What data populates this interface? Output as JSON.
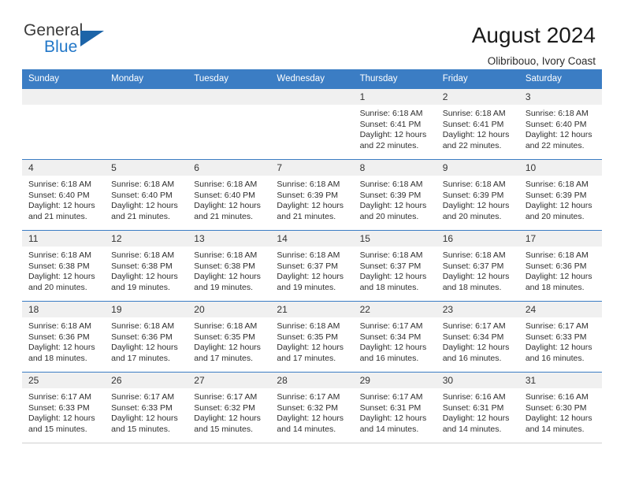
{
  "brand": {
    "name_part1": "General",
    "name_part2": "Blue",
    "triangle_color": "#1c64a8"
  },
  "header": {
    "title": "August 2024",
    "subtitle": "Olibribouo, Ivory Coast"
  },
  "theme": {
    "accent": "#3b7dc4",
    "header_text": "#ffffff",
    "daynum_band": "#f0f0f0",
    "body_text": "#2e2e2e"
  },
  "calendar": {
    "weekday_headers": [
      "Sunday",
      "Monday",
      "Tuesday",
      "Wednesday",
      "Thursday",
      "Friday",
      "Saturday"
    ],
    "weeks": [
      [
        {
          "day": "",
          "empty": true,
          "sunrise": "",
          "sunset": "",
          "daylight_line1": "",
          "daylight_line2": ""
        },
        {
          "day": "",
          "empty": true,
          "sunrise": "",
          "sunset": "",
          "daylight_line1": "",
          "daylight_line2": ""
        },
        {
          "day": "",
          "empty": true,
          "sunrise": "",
          "sunset": "",
          "daylight_line1": "",
          "daylight_line2": ""
        },
        {
          "day": "",
          "empty": true,
          "sunrise": "",
          "sunset": "",
          "daylight_line1": "",
          "daylight_line2": ""
        },
        {
          "day": "1",
          "empty": false,
          "sunrise": "Sunrise: 6:18 AM",
          "sunset": "Sunset: 6:41 PM",
          "daylight_line1": "Daylight: 12 hours",
          "daylight_line2": "and 22 minutes."
        },
        {
          "day": "2",
          "empty": false,
          "sunrise": "Sunrise: 6:18 AM",
          "sunset": "Sunset: 6:41 PM",
          "daylight_line1": "Daylight: 12 hours",
          "daylight_line2": "and 22 minutes."
        },
        {
          "day": "3",
          "empty": false,
          "sunrise": "Sunrise: 6:18 AM",
          "sunset": "Sunset: 6:40 PM",
          "daylight_line1": "Daylight: 12 hours",
          "daylight_line2": "and 22 minutes."
        }
      ],
      [
        {
          "day": "4",
          "empty": false,
          "sunrise": "Sunrise: 6:18 AM",
          "sunset": "Sunset: 6:40 PM",
          "daylight_line1": "Daylight: 12 hours",
          "daylight_line2": "and 21 minutes."
        },
        {
          "day": "5",
          "empty": false,
          "sunrise": "Sunrise: 6:18 AM",
          "sunset": "Sunset: 6:40 PM",
          "daylight_line1": "Daylight: 12 hours",
          "daylight_line2": "and 21 minutes."
        },
        {
          "day": "6",
          "empty": false,
          "sunrise": "Sunrise: 6:18 AM",
          "sunset": "Sunset: 6:40 PM",
          "daylight_line1": "Daylight: 12 hours",
          "daylight_line2": "and 21 minutes."
        },
        {
          "day": "7",
          "empty": false,
          "sunrise": "Sunrise: 6:18 AM",
          "sunset": "Sunset: 6:39 PM",
          "daylight_line1": "Daylight: 12 hours",
          "daylight_line2": "and 21 minutes."
        },
        {
          "day": "8",
          "empty": false,
          "sunrise": "Sunrise: 6:18 AM",
          "sunset": "Sunset: 6:39 PM",
          "daylight_line1": "Daylight: 12 hours",
          "daylight_line2": "and 20 minutes."
        },
        {
          "day": "9",
          "empty": false,
          "sunrise": "Sunrise: 6:18 AM",
          "sunset": "Sunset: 6:39 PM",
          "daylight_line1": "Daylight: 12 hours",
          "daylight_line2": "and 20 minutes."
        },
        {
          "day": "10",
          "empty": false,
          "sunrise": "Sunrise: 6:18 AM",
          "sunset": "Sunset: 6:39 PM",
          "daylight_line1": "Daylight: 12 hours",
          "daylight_line2": "and 20 minutes."
        }
      ],
      [
        {
          "day": "11",
          "empty": false,
          "sunrise": "Sunrise: 6:18 AM",
          "sunset": "Sunset: 6:38 PM",
          "daylight_line1": "Daylight: 12 hours",
          "daylight_line2": "and 20 minutes."
        },
        {
          "day": "12",
          "empty": false,
          "sunrise": "Sunrise: 6:18 AM",
          "sunset": "Sunset: 6:38 PM",
          "daylight_line1": "Daylight: 12 hours",
          "daylight_line2": "and 19 minutes."
        },
        {
          "day": "13",
          "empty": false,
          "sunrise": "Sunrise: 6:18 AM",
          "sunset": "Sunset: 6:38 PM",
          "daylight_line1": "Daylight: 12 hours",
          "daylight_line2": "and 19 minutes."
        },
        {
          "day": "14",
          "empty": false,
          "sunrise": "Sunrise: 6:18 AM",
          "sunset": "Sunset: 6:37 PM",
          "daylight_line1": "Daylight: 12 hours",
          "daylight_line2": "and 19 minutes."
        },
        {
          "day": "15",
          "empty": false,
          "sunrise": "Sunrise: 6:18 AM",
          "sunset": "Sunset: 6:37 PM",
          "daylight_line1": "Daylight: 12 hours",
          "daylight_line2": "and 18 minutes."
        },
        {
          "day": "16",
          "empty": false,
          "sunrise": "Sunrise: 6:18 AM",
          "sunset": "Sunset: 6:37 PM",
          "daylight_line1": "Daylight: 12 hours",
          "daylight_line2": "and 18 minutes."
        },
        {
          "day": "17",
          "empty": false,
          "sunrise": "Sunrise: 6:18 AM",
          "sunset": "Sunset: 6:36 PM",
          "daylight_line1": "Daylight: 12 hours",
          "daylight_line2": "and 18 minutes."
        }
      ],
      [
        {
          "day": "18",
          "empty": false,
          "sunrise": "Sunrise: 6:18 AM",
          "sunset": "Sunset: 6:36 PM",
          "daylight_line1": "Daylight: 12 hours",
          "daylight_line2": "and 18 minutes."
        },
        {
          "day": "19",
          "empty": false,
          "sunrise": "Sunrise: 6:18 AM",
          "sunset": "Sunset: 6:36 PM",
          "daylight_line1": "Daylight: 12 hours",
          "daylight_line2": "and 17 minutes."
        },
        {
          "day": "20",
          "empty": false,
          "sunrise": "Sunrise: 6:18 AM",
          "sunset": "Sunset: 6:35 PM",
          "daylight_line1": "Daylight: 12 hours",
          "daylight_line2": "and 17 minutes."
        },
        {
          "day": "21",
          "empty": false,
          "sunrise": "Sunrise: 6:18 AM",
          "sunset": "Sunset: 6:35 PM",
          "daylight_line1": "Daylight: 12 hours",
          "daylight_line2": "and 17 minutes."
        },
        {
          "day": "22",
          "empty": false,
          "sunrise": "Sunrise: 6:17 AM",
          "sunset": "Sunset: 6:34 PM",
          "daylight_line1": "Daylight: 12 hours",
          "daylight_line2": "and 16 minutes."
        },
        {
          "day": "23",
          "empty": false,
          "sunrise": "Sunrise: 6:17 AM",
          "sunset": "Sunset: 6:34 PM",
          "daylight_line1": "Daylight: 12 hours",
          "daylight_line2": "and 16 minutes."
        },
        {
          "day": "24",
          "empty": false,
          "sunrise": "Sunrise: 6:17 AM",
          "sunset": "Sunset: 6:33 PM",
          "daylight_line1": "Daylight: 12 hours",
          "daylight_line2": "and 16 minutes."
        }
      ],
      [
        {
          "day": "25",
          "empty": false,
          "sunrise": "Sunrise: 6:17 AM",
          "sunset": "Sunset: 6:33 PM",
          "daylight_line1": "Daylight: 12 hours",
          "daylight_line2": "and 15 minutes."
        },
        {
          "day": "26",
          "empty": false,
          "sunrise": "Sunrise: 6:17 AM",
          "sunset": "Sunset: 6:33 PM",
          "daylight_line1": "Daylight: 12 hours",
          "daylight_line2": "and 15 minutes."
        },
        {
          "day": "27",
          "empty": false,
          "sunrise": "Sunrise: 6:17 AM",
          "sunset": "Sunset: 6:32 PM",
          "daylight_line1": "Daylight: 12 hours",
          "daylight_line2": "and 15 minutes."
        },
        {
          "day": "28",
          "empty": false,
          "sunrise": "Sunrise: 6:17 AM",
          "sunset": "Sunset: 6:32 PM",
          "daylight_line1": "Daylight: 12 hours",
          "daylight_line2": "and 14 minutes."
        },
        {
          "day": "29",
          "empty": false,
          "sunrise": "Sunrise: 6:17 AM",
          "sunset": "Sunset: 6:31 PM",
          "daylight_line1": "Daylight: 12 hours",
          "daylight_line2": "and 14 minutes."
        },
        {
          "day": "30",
          "empty": false,
          "sunrise": "Sunrise: 6:16 AM",
          "sunset": "Sunset: 6:31 PM",
          "daylight_line1": "Daylight: 12 hours",
          "daylight_line2": "and 14 minutes."
        },
        {
          "day": "31",
          "empty": false,
          "sunrise": "Sunrise: 6:16 AM",
          "sunset": "Sunset: 6:30 PM",
          "daylight_line1": "Daylight: 12 hours",
          "daylight_line2": "and 14 minutes."
        }
      ]
    ]
  }
}
